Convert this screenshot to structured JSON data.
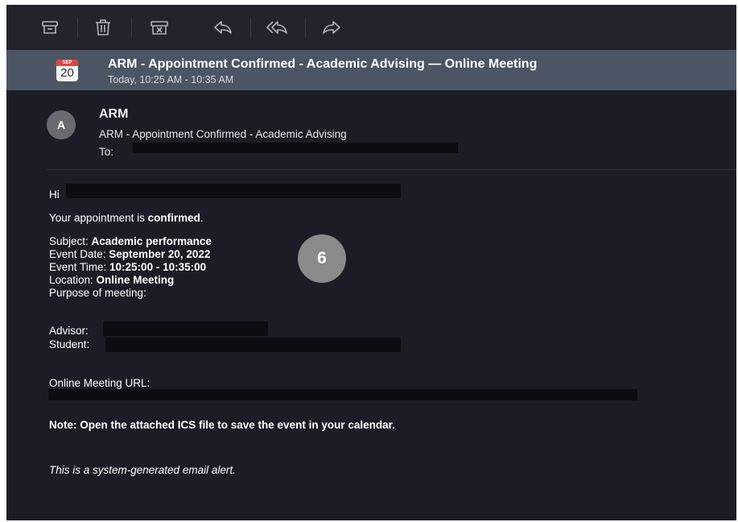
{
  "toolbar": {
    "icons": [
      "archive-icon",
      "trash-icon",
      "junk-icon",
      "reply-icon",
      "reply-all-icon",
      "forward-icon"
    ]
  },
  "event": {
    "calendar_month": "SEP",
    "calendar_day": "20",
    "title": "ARM - Appointment Confirmed - Academic Advising — Online Meeting",
    "time": "Today, 10:25 AM - 10:35 AM"
  },
  "message": {
    "avatar_initial": "A",
    "sender": "ARM",
    "subject": "ARM - Appointment Confirmed - Academic Advising",
    "to_label": "To:"
  },
  "body": {
    "greeting": "Hi",
    "confirm_prefix": "Your appointment is ",
    "confirm_bold": "confirmed",
    "confirm_suffix": ".",
    "subject_label": "Subject: ",
    "subject_value": "Academic performance",
    "date_label": "Event Date: ",
    "date_value": "September 20, 2022",
    "time_label": "Event Time: ",
    "time_value": "10:25:00 - 10:35:00",
    "location_label": "Location: ",
    "location_value": "Online Meeting",
    "purpose_label": "Purpose of meeting:",
    "advisor_label": "Advisor:",
    "student_label": "Student:",
    "url_label": "Online Meeting URL:",
    "note": "Note: Open the attached ICS file to save the event in your calendar.",
    "footer": "This is a system-generated email alert."
  },
  "annotation": {
    "badge_number": "6"
  }
}
